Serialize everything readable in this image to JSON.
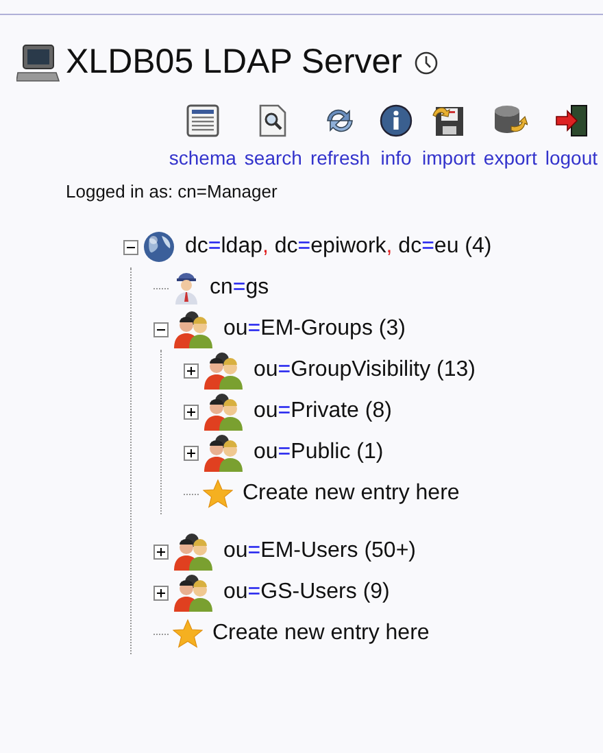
{
  "header": {
    "title": "XLDB05 LDAP Server"
  },
  "toolbar": [
    {
      "kind": "schema",
      "label": "schema"
    },
    {
      "kind": "search",
      "label": "search"
    },
    {
      "kind": "refresh",
      "label": "refresh"
    },
    {
      "kind": "info",
      "label": "info"
    },
    {
      "kind": "import",
      "label": "import"
    },
    {
      "kind": "export",
      "label": "export"
    },
    {
      "kind": "logout",
      "label": "logout"
    }
  ],
  "login": "Logged in as: cn=Manager",
  "tree": [
    {
      "kind": "domain",
      "expanded": true,
      "label": [
        {
          "kind": "name",
          "text": "dc"
        },
        {
          "kind": "equals",
          "text": "="
        },
        {
          "kind": "name",
          "text": "ldap"
        },
        {
          "kind": "comma",
          "text": ","
        },
        {
          "kind": "name",
          "text": " dc"
        },
        {
          "kind": "equals",
          "text": "="
        },
        {
          "kind": "name",
          "text": "epiwork"
        },
        {
          "kind": "comma",
          "text": ","
        },
        {
          "kind": "name",
          "text": " dc"
        },
        {
          "kind": "equals",
          "text": "="
        },
        {
          "kind": "name",
          "text": "eu (4)"
        }
      ],
      "children": [
        {
          "kind": "person",
          "label": [
            {
              "kind": "name",
              "text": "cn"
            },
            {
              "kind": "equals",
              "text": "="
            },
            {
              "kind": "name",
              "text": "gs"
            }
          ]
        },
        {
          "kind": "group",
          "expanded": true,
          "label": [
            {
              "kind": "name",
              "text": "ou"
            },
            {
              "kind": "equals",
              "text": "="
            },
            {
              "kind": "name",
              "text": "EM-Groups (3)"
            }
          ],
          "children": [
            {
              "kind": "group",
              "expanded": false,
              "label": [
                {
                  "kind": "name",
                  "text": "ou"
                },
                {
                  "kind": "equals",
                  "text": "="
                },
                {
                  "kind": "name",
                  "text": "GroupVisibility (13)"
                }
              ]
            },
            {
              "kind": "group",
              "expanded": false,
              "label": [
                {
                  "kind": "name",
                  "text": "ou"
                },
                {
                  "kind": "equals",
                  "text": "="
                },
                {
                  "kind": "name",
                  "text": "Private (8)"
                }
              ]
            },
            {
              "kind": "group",
              "expanded": false,
              "label": [
                {
                  "kind": "name",
                  "text": "ou"
                },
                {
                  "kind": "equals",
                  "text": "="
                },
                {
                  "kind": "name",
                  "text": "Public (1)"
                }
              ]
            },
            {
              "kind": "create",
              "label": [
                {
                  "kind": "name",
                  "text": "Create new entry here"
                }
              ]
            }
          ]
        },
        {
          "kind": "group",
          "expanded": false,
          "label": [
            {
              "kind": "name",
              "text": "ou"
            },
            {
              "kind": "equals",
              "text": "="
            },
            {
              "kind": "name",
              "text": "EM-Users (50+)"
            }
          ]
        },
        {
          "kind": "group",
          "expanded": false,
          "label": [
            {
              "kind": "name",
              "text": "ou"
            },
            {
              "kind": "equals",
              "text": "="
            },
            {
              "kind": "name",
              "text": "GS-Users (9)"
            }
          ]
        },
        {
          "kind": "create",
          "label": [
            {
              "kind": "name",
              "text": "Create new entry here"
            }
          ]
        }
      ]
    }
  ]
}
